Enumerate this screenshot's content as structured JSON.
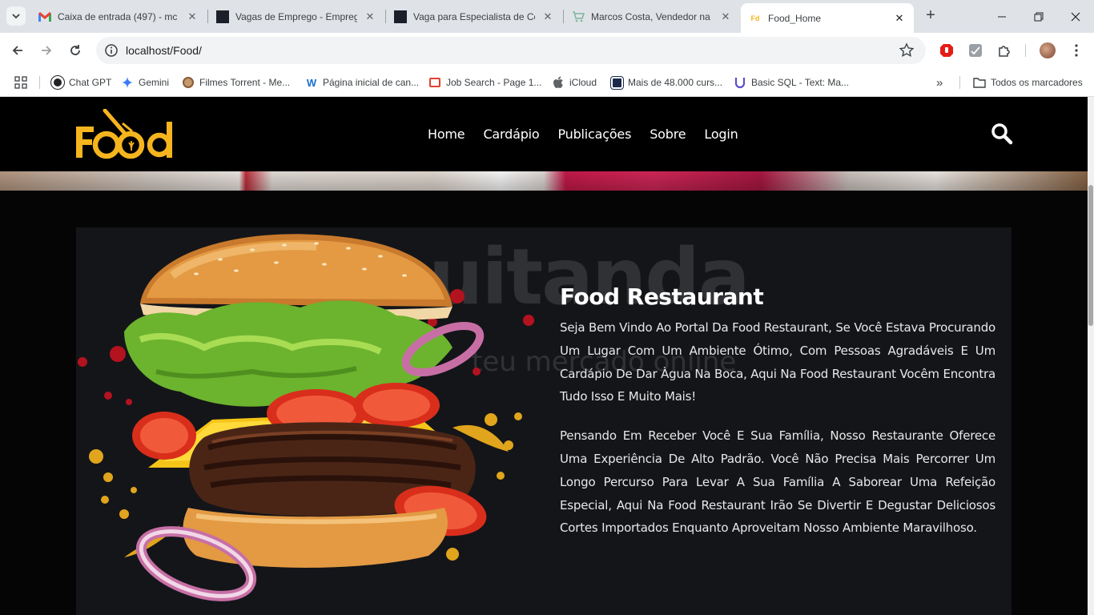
{
  "browser": {
    "tabs": [
      {
        "title": "Caixa de entrada (497) - mc",
        "icon": "gmail-icon"
      },
      {
        "title": "Vagas de Emprego - Empreg",
        "icon": "site-dark-icon"
      },
      {
        "title": "Vaga para Especialista de Co",
        "icon": "site-dark-icon"
      },
      {
        "title": "Marcos Costa, Vendedor na",
        "icon": "cart-icon"
      },
      {
        "title": "Food_Home",
        "icon": "food-favicon"
      }
    ],
    "active_tab": 4,
    "url": "localhost/Food/",
    "bookmarks": [
      {
        "label": "Chat GPT",
        "icon": "chatgpt-icon"
      },
      {
        "label": "Gemini",
        "icon": "gemini-icon"
      },
      {
        "label": "Filmes Torrent - Me...",
        "icon": "torrent-icon"
      },
      {
        "label": "Página inicial de can...",
        "icon": "w-icon"
      },
      {
        "label": "Job Search - Page 1...",
        "icon": "job-icon"
      },
      {
        "label": "iCloud",
        "icon": "apple-icon"
      },
      {
        "label": "Mais de 48.000 curs...",
        "icon": "course-icon"
      },
      {
        "label": "Basic SQL - Text: Ma...",
        "icon": "u-icon"
      }
    ],
    "all_bookmarks": "Todos os marcadores",
    "overflow": "»"
  },
  "site": {
    "logo_text": "Food",
    "accent": "#f6b51e",
    "nav": [
      "Home",
      "Cardápio",
      "Publicações",
      "Sobre",
      "Login"
    ],
    "about": {
      "title": "Food Restaurant",
      "paragraph1": "Seja Bem Vindo Ao Portal Da Food Restaurant, Se Você Estava Procurando Um Lugar Com Um Ambiente Ótimo, Com Pessoas Agradáveis E Um Cardápio De Dar Àgua Na Boca, Aqui Na Food Restaurant Vocêm Encontra Tudo Isso E Muito Mais!",
      "paragraph2": "Pensando Em Receber Você E Sua Família, Nosso Restaurante Oferece Uma Experiência De Alto Padrão. Você Não Precisa Mais Percorrer Um Longo Percurso Para Levar A Sua Família A Saborear Uma Refeição Especial, Aqui Na Food Restaurant Irão Se Divertir E Degustar Deliciosos Cortes Importados Enquanto Aproveitam Nosso Ambiente Maravilhoso.",
      "watermark": "uitanda",
      "watermark_sub": "teu mercado online"
    }
  }
}
